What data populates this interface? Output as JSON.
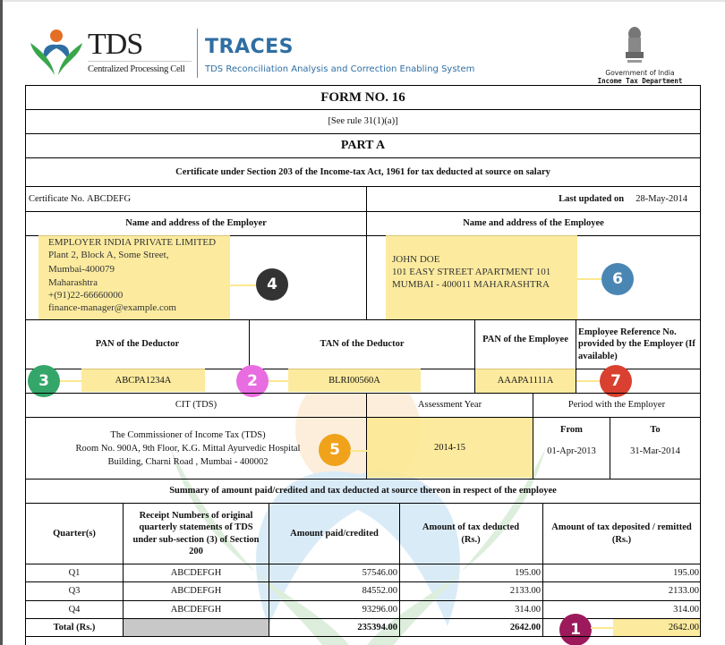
{
  "header": {
    "logo_title": "TDS",
    "logo_subtitle": "Centralized Processing Cell",
    "app_name": "TRACES",
    "app_fullname": "TDS Reconciliation Analysis and Correction Enabling System",
    "gov_line1": "Government of India",
    "gov_line2": "Income Tax Department"
  },
  "form": {
    "title": "FORM NO. 16",
    "rule": "[See rule 31(1)(a)]",
    "part": "PART A",
    "certificate_heading": "Certificate under Section 203 of the Income-tax Act, 1961 for tax deducted at source on salary",
    "certificate_no_label": "Certificate No.",
    "certificate_no": "ABCDEFG",
    "last_updated_label": "Last updated on",
    "last_updated": "28-May-2014",
    "employer_heading": "Name and address of the Employer",
    "employee_heading": "Name and address of the Employee",
    "employer_address": [
      "EMPLOYER INDIA PRIVATE LIMITED",
      "Plant 2, Block A, Some Street,",
      "Mumbai-400079",
      "Maharashtra",
      "+(91)22-66660000",
      "finance-manager@example.com"
    ],
    "employee_address": [
      "JOHN DOE",
      "101 EASY STREET APARTMENT 101",
      "MUMBAI - 400011 MAHARASHTRA"
    ],
    "pan_deductor_label": "PAN of the Deductor",
    "tan_deductor_label": "TAN of the Deductor",
    "pan_employee_label": "PAN of the Employee",
    "emp_ref_label": "Employee Reference No. provided by the Employer (If available)",
    "pan_deductor": "ABCPA1234A",
    "tan_deductor": "BLRI00560A",
    "pan_employee": "AAAPA1111A",
    "emp_ref": "",
    "cit_label": "CIT (TDS)",
    "assessment_year_label": "Assessment Year",
    "period_label": "Period with the Employer",
    "cit_address": [
      "The Commissioner of Income Tax (TDS)",
      "Room No. 900A, 9th Floor, K.G. Mittal Ayurvedic Hospital",
      "Building, Charni Road , Mumbai - 400002"
    ],
    "assessment_year": "2014-15",
    "from_label": "From",
    "to_label": "To",
    "period_from": "01-Apr-2013",
    "period_to": "31-Mar-2014",
    "summary_heading": "Summary of amount paid/credited and tax deducted at source thereon in respect of the employee",
    "table": {
      "headers": [
        "Quarter(s)",
        "Receipt Numbers of original quarterly statements of TDS under sub-section (3) of Section 200",
        "Amount paid/credited",
        "Amount of tax deducted (Rs.)",
        "Amount of tax deposited / remitted (Rs.)"
      ],
      "rows": [
        [
          "Q1",
          "ABCDEFGH",
          "57546.00",
          "195.00",
          "195.00"
        ],
        [
          "Q3",
          "ABCDEFGH",
          "84552.00",
          "2133.00",
          "2133.00"
        ],
        [
          "Q4",
          "ABCDEFGH",
          "93296.00",
          "314.00",
          "314.00"
        ]
      ],
      "total": [
        "Total (Rs.)",
        "",
        "235394.00",
        "2642.00",
        "2642.00"
      ]
    }
  },
  "annotations": [
    {
      "label": "1",
      "color": "#9c1a5c"
    },
    {
      "label": "2",
      "color": "#e86de0"
    },
    {
      "label": "3",
      "color": "#35a66a"
    },
    {
      "label": "4",
      "color": "#333333"
    },
    {
      "label": "5",
      "color": "#f0a21a"
    },
    {
      "label": "6",
      "color": "#4a86b4"
    },
    {
      "label": "7",
      "color": "#d9402f"
    }
  ]
}
